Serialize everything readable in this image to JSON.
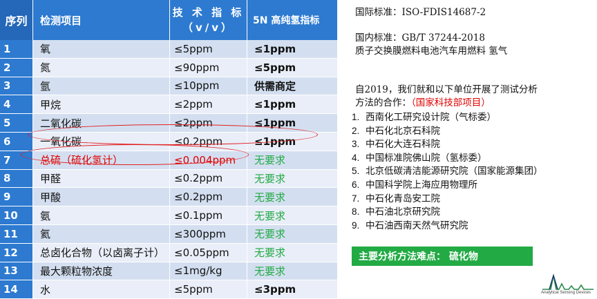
{
  "table": {
    "headers": {
      "seq": "序列",
      "item": "检测项目",
      "spec_line1": "技 术 指 标",
      "spec_line2": "（v/v）",
      "fiveN": "5N 高纯氢指标"
    },
    "rows": [
      {
        "seq": "1",
        "item": "氧",
        "spec": "≤5ppm",
        "fiveN": "≤1ppm",
        "fiveN_style": "bold"
      },
      {
        "seq": "2",
        "item": "氮",
        "spec": "≤90ppm",
        "fiveN": "≤5ppm",
        "fiveN_style": "bold"
      },
      {
        "seq": "3",
        "item": "氩",
        "spec": "≤10ppm",
        "fiveN": "供需商定",
        "fiveN_style": "bold"
      },
      {
        "seq": "4",
        "item": "甲烷",
        "spec": "≤2ppm",
        "fiveN": "≤1ppm",
        "fiveN_style": "bold"
      },
      {
        "seq": "5",
        "item": "二氧化碳",
        "spec": "≤2ppm",
        "fiveN": "≤1ppm",
        "fiveN_style": "bold"
      },
      {
        "seq": "6",
        "item": "一氧化碳",
        "spec": "≤0.2ppm",
        "fiveN": "≤1ppm",
        "fiveN_style": "bold"
      },
      {
        "seq": "7",
        "item": "总硫（硫化氢计）",
        "spec": "≤0.004ppm",
        "fiveN": "无要求",
        "fiveN_style": "green"
      },
      {
        "seq": "8",
        "item": "甲醛",
        "spec": "≤0.2ppm",
        "fiveN": "无要求",
        "fiveN_style": "green"
      },
      {
        "seq": "9",
        "item": "甲酸",
        "spec": "≤0.2ppm",
        "fiveN": "无要求",
        "fiveN_style": "green"
      },
      {
        "seq": "10",
        "item": "氨",
        "spec": "≤0.1ppm",
        "fiveN": "无要求",
        "fiveN_style": "green"
      },
      {
        "seq": "11",
        "item": "氦",
        "spec": "≤300ppm",
        "fiveN": "无要求",
        "fiveN_style": "green"
      },
      {
        "seq": "12",
        "item": "总卤化合物（以卤离子计）",
        "spec": "≤0.05ppm",
        "fiveN": "无要求",
        "fiveN_style": "green"
      },
      {
        "seq": "13",
        "item": "最大颗粒物浓度",
        "spec": "≤1mg/kg",
        "fiveN": "无要求",
        "fiveN_style": "green"
      },
      {
        "seq": "14",
        "item": "水",
        "spec": "≤5ppm",
        "fiveN": "≤3ppm",
        "fiveN_style": "bold"
      }
    ],
    "highlight_color": "#e00000",
    "header_color": "#2d7ad0"
  },
  "right": {
    "intl_std": "国际标准：ISO-FDIS14687-2",
    "cn_std_line1": "国内标准：GB/T 37244-2018",
    "cn_std_line2": "质子交换膜燃料电池汽车用燃料 氢气",
    "intro_line1": "自2019，我们就和以下单位开展了测试分析",
    "intro_line2_prefix": "方法的合作：",
    "intro_line2_red": "（国家科技部项目）",
    "partners": [
      {
        "num": "1.",
        "name": "西南化工研究设计院（气标委）"
      },
      {
        "num": "2.",
        "name": "中石化北京石科院"
      },
      {
        "num": "3.",
        "name": "中石化大连石科院"
      },
      {
        "num": "4.",
        "name": "中国标准院佛山院（氢标委）"
      },
      {
        "num": "5.",
        "name": "北京低碳清洁能源研究院（国家能源集团）"
      },
      {
        "num": "6.",
        "name": "中国科学院上海应用物理所"
      },
      {
        "num": "7.",
        "name": "中石化青岛安工院"
      },
      {
        "num": "8.",
        "name": "中石油北京研究院"
      },
      {
        "num": "9.",
        "name": "中石油西南天然气研究院"
      }
    ],
    "banner": "主要分析方法难点： 硫化物",
    "banner_color": "#22aa44"
  },
  "logo": {
    "text": "Analytical Sensing Devices",
    "icon": "waveform-logo-icon"
  }
}
